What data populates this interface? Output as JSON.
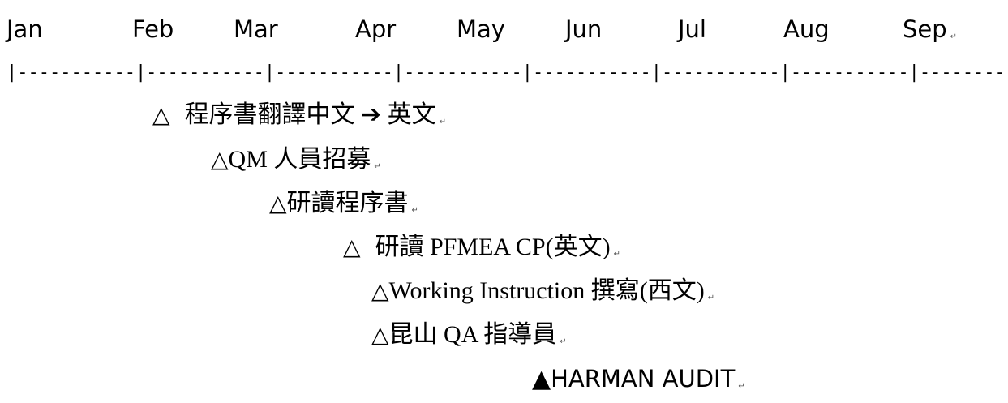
{
  "paragraph_mark": "↵",
  "ruler_text": "|-----------|-----------|-----------|-----------|-----------|-----------|-----------|-----------|-----------|----------",
  "months": [
    "Jan",
    "Feb",
    "Mar",
    "Apr",
    "May",
    "Jun",
    "Jul",
    "Aug",
    "Sep"
  ],
  "items": [
    {
      "marker": "△",
      "text": "程序書翻譯中文 ➔ 英文"
    },
    {
      "marker": "△",
      "text": "QM 人員招募"
    },
    {
      "marker": "△",
      "text": "研讀程序書"
    },
    {
      "marker": "△",
      "text": "研讀 PFMEA CP(英文)"
    },
    {
      "marker": "△",
      "text": "Working Instruction 撰寫(西文)"
    },
    {
      "marker": "△",
      "text": "昆山 QA 指導員"
    },
    {
      "marker": "▲",
      "text": "HARMAN AUDIT"
    }
  ]
}
